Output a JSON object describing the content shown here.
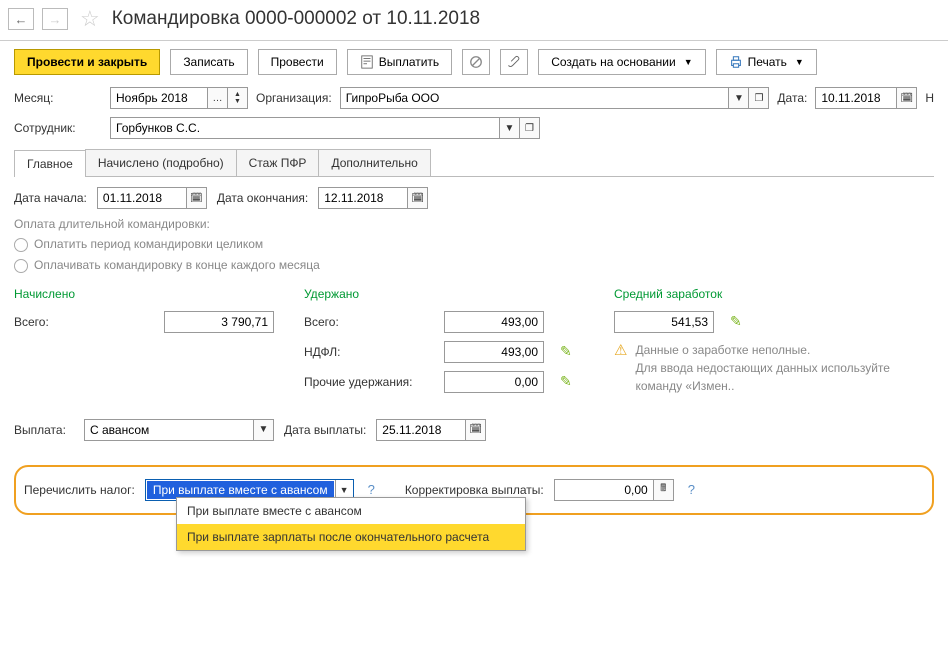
{
  "header": {
    "title": "Командировка 0000-000002 от 10.11.2018"
  },
  "toolbar": {
    "post_close": "Провести и закрыть",
    "save": "Записать",
    "post": "Провести",
    "pay": "Выплатить",
    "create_based": "Создать на основании",
    "print": "Печать"
  },
  "fields": {
    "month_label": "Месяц:",
    "month_value": "Ноябрь 2018",
    "org_label": "Организация:",
    "org_value": "ГипроРыба ООО",
    "date_label": "Дата:",
    "date_value": "10.11.2018",
    "employee_label": "Сотрудник:",
    "employee_value": "Горбунков С.С."
  },
  "tabs": {
    "main": "Главное",
    "accrued": "Начислено (подробно)",
    "pfr": "Стаж ПФР",
    "extra": "Дополнительно"
  },
  "main": {
    "start_label": "Дата начала:",
    "start_value": "01.11.2018",
    "end_label": "Дата окончания:",
    "end_value": "12.11.2018",
    "long_trip_label": "Оплата длительной командировки:",
    "radio1": "Оплатить период командировки целиком",
    "radio2": "Оплачивать командировку в конце каждого месяца",
    "accrued_header": "Начислено",
    "deducted_header": "Удержано",
    "avg_header": "Средний заработок",
    "total_label": "Всего:",
    "total_value": "3 790,71",
    "ded_total_label": "Всего:",
    "ded_total_value": "493,00",
    "ndfl_label": "НДФЛ:",
    "ndfl_value": "493,00",
    "other_ded_label": "Прочие удержания:",
    "other_ded_value": "0,00",
    "avg_value": "541,53",
    "warn_line1": "Данные о заработке неполные.",
    "warn_line2": "Для ввода недостающих данных используйте команду «Измен..",
    "payout_label": "Выплата:",
    "payout_value": "С авансом",
    "payout_date_label": "Дата выплаты:",
    "payout_date_value": "25.11.2018"
  },
  "tax": {
    "transfer_label": "Перечислить налог:",
    "selected": "При выплате вместе с авансом",
    "option1": "При выплате вместе с авансом",
    "option2": "При выплате зарплаты после окончательного расчета",
    "corr_label": "Корректировка выплаты:",
    "corr_value": "0,00"
  }
}
